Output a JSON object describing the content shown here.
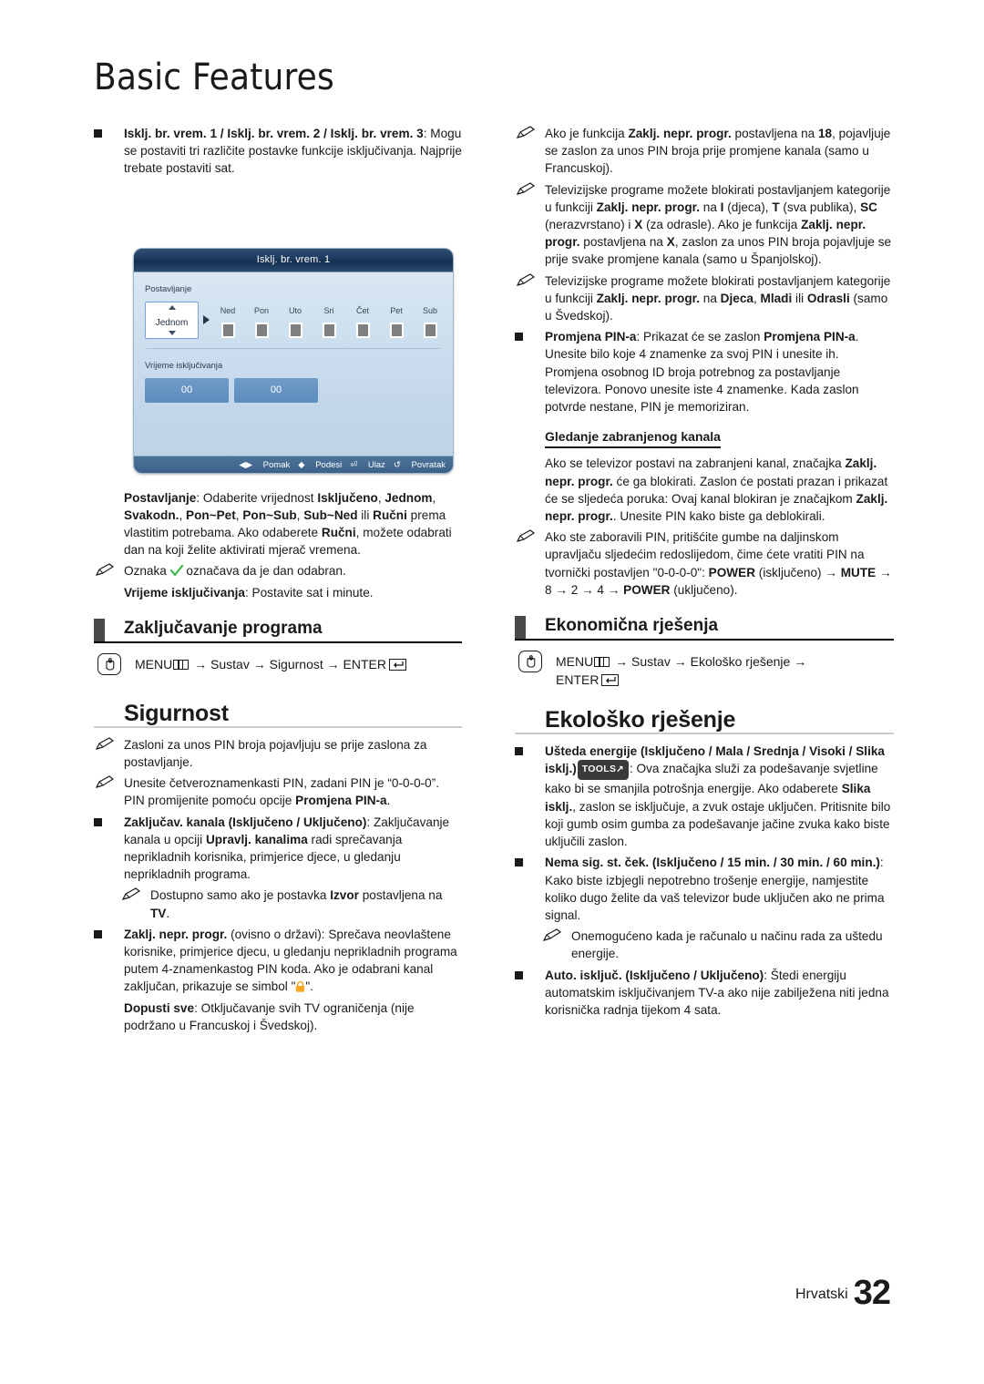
{
  "page": {
    "title": "Basic Features",
    "footer_language": "Hrvatski",
    "footer_page_number": "32",
    "accent_bar_color": "#4a4a4a",
    "lock_icon_color": "#f5a623",
    "check_icon_color": "#3cb54a"
  },
  "osd": {
    "title": "Isklj. br. vrem. 1",
    "setting_label": "Postavljanje",
    "setting_value": "Jednom",
    "days": [
      "Ned",
      "Pon",
      "Uto",
      "Sri",
      "Čet",
      "Pet",
      "Sub"
    ],
    "time_label": "Vrijeme isključivanja",
    "time_hour": "00",
    "time_minute": "00",
    "hints": [
      {
        "icon": "left-right-arrows",
        "label": "Pomak"
      },
      {
        "icon": "up-down-arrows",
        "label": "Podesi"
      },
      {
        "icon": "enter-key",
        "label": "Ulaz"
      },
      {
        "icon": "return-arrow",
        "label": "Povratak"
      }
    ]
  },
  "left": {
    "b1": {
      "bold": "Isklj. br. vrem. 1 / Isklj. br. vrem. 2 / Isklj. br. vrem. ",
      "bold2": "3",
      "rest": ": Mogu se postaviti tri različite postavke funkcije isključivanja. Najprije trebate postaviti sat."
    },
    "postavljanje": {
      "b1": "Postavljanje",
      "t1": ": Odaberite vrijednost ",
      "b2": "Isključeno",
      "t2": ", ",
      "b3": "Jednom",
      "t3": ", ",
      "b4": "Svakodn.",
      "t4": ", ",
      "b5": "Pon~Pet",
      "t5": ", ",
      "b6": "Pon~Sub",
      "t6": ", ",
      "b7": "Sub~Ned",
      "t7": " ili ",
      "b8": "Ručni",
      "t8": " prema vlastitim potrebama. Ako odaberete ",
      "b9": "Ručni",
      "t9": ", možete odabrati dan na koji želite aktivirati mjerač vremena."
    },
    "oznaka": {
      "t1": "Oznaka ",
      "t2": " označava da je dan odabran."
    },
    "vrijeme": {
      "b1": "Vrijeme isključivanja",
      "t1": ": Postavite sat i minute."
    },
    "sec_zakljucavanje": "Zaključavanje programa",
    "menu_path_1": {
      "menu": "MENU",
      "a1": "→",
      "s1": "Sustav",
      "a2": "→",
      "s2": "Sigurnost",
      "a3": "→",
      "enter": "ENTER"
    },
    "head_sigurnost": "Sigurnost",
    "note1": "Zasloni za unos PIN broja pojavljuju se prije zaslona za postavljanje.",
    "note2": {
      "t1": "Unesite četveroznamenkasti PIN, zadani PIN je “0-0-0-0”. PIN promijenite pomoću opcije ",
      "b1": "Promjena PIN-a",
      "t2": "."
    },
    "b_zakljucav": {
      "b1": "Zaključav. kanala (Isključeno / Uključeno)",
      "t1": ": Zaključavanje kanala u opciji ",
      "b2": "Upravlj. kanalima",
      "t2": " radi sprečavanja neprikladnih korisnika, primjerice djece, u gledanju neprikladnih programa."
    },
    "note3": {
      "t1": "Dostupno samo ako je postavka ",
      "b1": "Izvor",
      "t2": " postavljena na ",
      "b2": "TV",
      "t3": "."
    },
    "b_zaklj_nepr": {
      "b1": "Zaklj. nepr. progr.",
      "t1": " (ovisno o državi): Sprečava neovlaštene korisnike, primjerice djecu, u gledanju neprikladnih programa putem 4-znamenkastog PIN koda. Ako je odabrani kanal zaključan, prikazuje se simbol \"",
      "t2": "\"."
    },
    "dopusti": {
      "b1": "Dopusti sve",
      "t1": ": Otključavanje svih TV ograničenja (nije podržano u Francuskoj i Švedskoj)."
    }
  },
  "right": {
    "note1": {
      "t1": "Ako je funkcija ",
      "b1": "Zaklj. nepr. progr.",
      "t2": " postavljena na ",
      "b2": "18",
      "t3": ", pojavljuje se zaslon za unos PIN broja prije promjene kanala (samo u Francuskoj)."
    },
    "note2": {
      "t1": "Televizijske programe možete blokirati postavljanjem kategorije u funkciji ",
      "b1": "Zaklj. nepr. progr.",
      "t2": " na ",
      "b2": "I",
      "t3": " (djeca), ",
      "b3": "T",
      "t4": " (sva publika), ",
      "b4": "SC",
      "t5": " (nerazvrstano) i ",
      "b5": "X",
      "t6": " (za odrasle). Ako je funkcija ",
      "b6": "Zaklj. nepr. progr.",
      "t7": " postavljena na ",
      "b7": "X",
      "t8": ", zaslon za unos PIN broja pojavljuje se prije svake promjene kanala (samo u Španjolskoj)."
    },
    "note3": {
      "t1": "Televizijske programe možete blokirati postavljanjem kategorije u funkciji ",
      "b1": "Zaklj. nepr. progr.",
      "t2": " na ",
      "b2": "Djeca",
      "t3": ", ",
      "b3": "Mladi",
      "t4": " ili ",
      "b4": "Odrasli",
      "t5": " (samo u Švedskoj)."
    },
    "b_promjena": {
      "b1": "Promjena PIN-a",
      "t1": ": Prikazat će se zaslon ",
      "b2": "Promjena PIN-a",
      "t2": ". Unesite bilo koje 4 znamenke za svoj PIN i unesite ih. Promjena osobnog ID broja potrebnog za postavljanje televizora. Ponovo unesite iste 4 znamenke. Kada zaslon potvrde nestane, PIN je memoriziran."
    },
    "sub_head": "Gledanje zabranjenog kanala",
    "para1": {
      "t1": "Ako se televizor postavi na zabranjeni kanal, značajka ",
      "b1": "Zaklj. nepr. progr.",
      "t2": " će ga blokirati. Zaslon će postati prazan i prikazat će se sljedeća poruka: Ovaj kanal blokiran je značajkom ",
      "b2": "Zaklj. nepr. progr.",
      "t3": ". Unesite PIN kako biste ga deblokirali."
    },
    "note4": {
      "t1": "Ako ste zaboravili PIN, pritišćite gumbe na daljinskom upravljaču sljedećim redoslijedom, čime ćete vratiti PIN na tvornički postavljen \"0-0-0-0\": ",
      "b1": "POWER",
      "t2": " (isključeno) → ",
      "b2": "MUTE",
      "t3": " → 8 → 2 → 4 → ",
      "b3": "POWER",
      "t4": " (uključeno)."
    },
    "sec_ekonomicna": "Ekonomična rješenja",
    "menu_path_2": {
      "menu": "MENU",
      "a1": "→",
      "s1": "Sustav",
      "a2": "→",
      "s2": "Ekološko rješenje",
      "a3": "→",
      "enter": "ENTER"
    },
    "head_ekolosko": "Ekološko rješenje",
    "b_usteda": {
      "b1": "Ušteda energije (Isključeno / Mala / Srednja / Visoki / Slika isklj.)",
      "badge": "TOOLS",
      "t1": ": Ova značajka služi za podešavanje svjetline kako bi se smanjila potrošnja energije. Ako odaberete ",
      "b2": "Slika isklj.",
      "t2": ", zaslon se isključuje, a zvuk ostaje uključen. Pritisnite bilo koji gumb osim gumba za podešavanje jačine zvuka kako biste uključili zaslon."
    },
    "b_nema_sig": {
      "b1": "Nema sig. st. ček. (Isključeno / 15 min. / 30 min. / 60 min.)",
      "t1": ": Kako biste izbjegli nepotrebno trošenje energije, namjestite koliko dugo želite da vaš televizor bude uključen ako ne prima signal."
    },
    "note5": "Onemogućeno kada je računalo u načinu rada za uštedu energije.",
    "b_auto": {
      "b1": "Auto. isključ. (Isključeno / Uključeno)",
      "t1": ": Štedi energiju automatskim isključivanjem TV-a ako nije zabilježena niti jedna korisnička radnja tijekom 4 sata."
    }
  }
}
